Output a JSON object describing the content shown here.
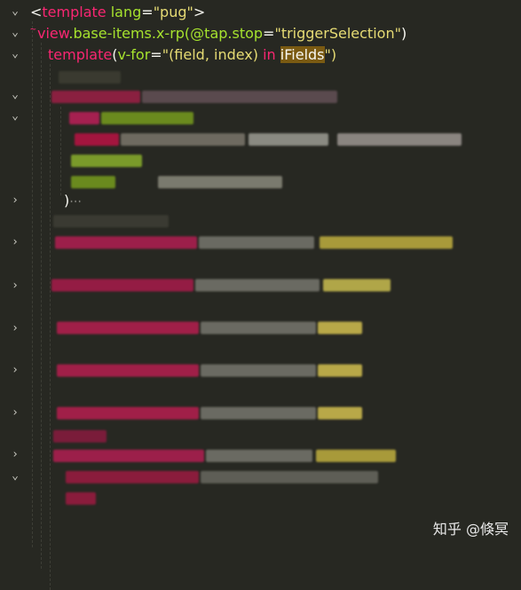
{
  "editor": {
    "line1": {
      "lt": "<",
      "tag": "template",
      "sp": " ",
      "attr": "lang",
      "eq": "=",
      "val": "\"pug\"",
      "gt": ">"
    },
    "line2": {
      "tag": "view",
      "cls": ".base-items.x-rp(",
      "attr": "@tap.stop",
      "eq": "=",
      "val": "\"triggerSelection\"",
      "close": ")"
    },
    "line3": {
      "tag": "template",
      "paren": "(",
      "attr": "v-for",
      "eq": "=",
      "val_open": "\"(field, index) ",
      "kw": "in",
      "sp": " ",
      "hl": "iFields",
      "val_close": "\")"
    },
    "folded": {
      "brace": ")",
      "dots": "⋯"
    }
  },
  "watermark": "知乎 @倏冥",
  "icons": {
    "expanded": "chevron-down-icon",
    "collapsed": "chevron-right-icon"
  },
  "colors": {
    "background": "#272822",
    "tag": "#f92672",
    "attribute": "#a6e22e",
    "string": "#e6db74",
    "text": "#f8f8f2",
    "highlight": "#7a5a12"
  }
}
